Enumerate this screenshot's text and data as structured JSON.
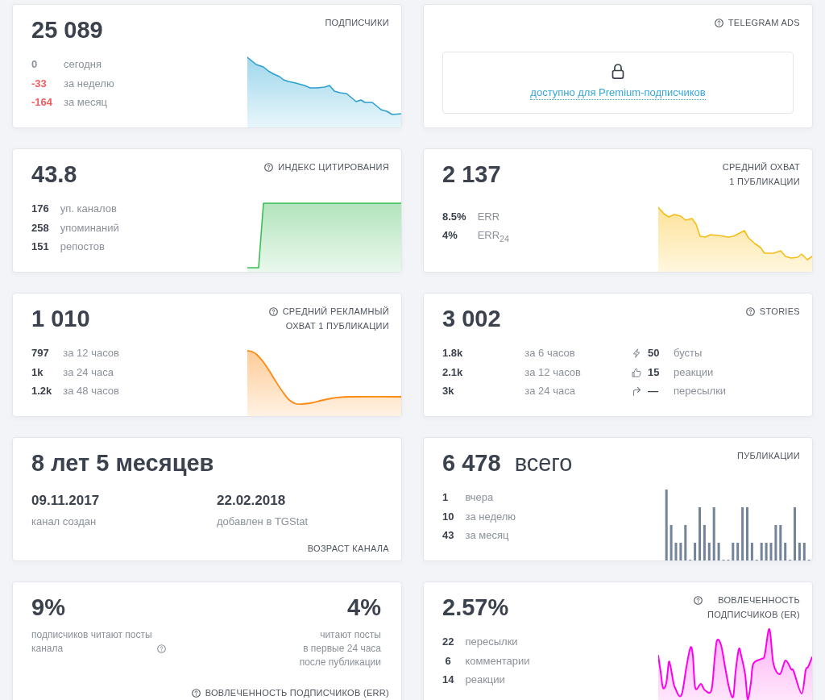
{
  "cards": [
    {
      "kind": "metric",
      "title": "ПОДПИСЧИКИ",
      "help_icon": false,
      "value": "25 089",
      "stats": [
        {
          "value": "0",
          "label": "сегодня",
          "color": "#8b919b"
        },
        {
          "value": "-33",
          "label": "за неделю",
          "color": "#f25c5e"
        },
        {
          "value": "-164",
          "label": "за месяц",
          "color": "#f25c5e"
        }
      ]
    },
    {
      "kind": "locked",
      "title": "TELEGRAM ADS",
      "help_icon": true,
      "link": "доступно для Premium-подписчиков"
    },
    {
      "kind": "metric",
      "title": "ИНДЕКС ЦИТИРОВАНИЯ",
      "help_icon": true,
      "value": "43.8",
      "stats": [
        {
          "value": "176",
          "label": "уп. каналов"
        },
        {
          "value": "258",
          "label": "упоминаний"
        },
        {
          "value": "151",
          "label": "репостов"
        }
      ]
    },
    {
      "kind": "metric",
      "title": "СРЕДНИЙ ОХВАТ\n1 ПУБЛИКАЦИИ",
      "help_icon": false,
      "value": "2 137",
      "stats": [
        {
          "value": "8.5%",
          "label": "ERR"
        },
        {
          "value": "4%",
          "label": "ERR$_{24}$"
        }
      ]
    },
    {
      "kind": "metric",
      "title": "СРЕДНИЙ РЕКЛАМНЫЙ\nОХВАТ 1 ПУБЛИКАЦИИ",
      "help_icon": true,
      "value": "1 010",
      "stats": [
        {
          "value": "797",
          "label": "за 12 часов"
        },
        {
          "value": "1k",
          "label": "за 24 часа"
        },
        {
          "value": "1.2k",
          "label": "за 48 часов"
        }
      ]
    },
    {
      "kind": "stories",
      "title": "STORIES",
      "help_icon": true,
      "value": "3 002",
      "stats": [
        {
          "value": "1.8k",
          "label": "за 6 часов"
        },
        {
          "value": "2.1k",
          "label": "за 12 часов"
        },
        {
          "value": "3k",
          "label": "за 24 часа"
        }
      ],
      "extras": [
        {
          "kind": "boost",
          "value": "50",
          "label": "бусты"
        },
        {
          "kind": "like",
          "value": "15",
          "label": "реакции"
        },
        {
          "kind": "forward",
          "value": "—",
          "label": "пересылки"
        }
      ]
    },
    {
      "kind": "age",
      "title": "ВОЗРАСТ КАНАЛА",
      "help_icon": false,
      "value": "8 лет 5 месяцев",
      "dates": [
        {
          "date": "09.11.2017",
          "caption": "канал создан"
        },
        {
          "date": "22.02.2018",
          "caption": "добавлен в TGStat"
        }
      ]
    },
    {
      "kind": "metric",
      "title": "ПУБЛИКАЦИИ",
      "help_icon": false,
      "value": "6 478",
      "unit": "всего",
      "stats": [
        {
          "value": "1",
          "label": "вчера"
        },
        {
          "value": "10",
          "label": "за неделю"
        },
        {
          "value": "43",
          "label": "за месяц"
        }
      ]
    },
    {
      "kind": "ratio",
      "title": "ВОВЛЕЧЕННОСТЬ ПОДПИСЧИКОВ (ERR)",
      "help_icon": true,
      "columns": [
        {
          "value": "9%",
          "caption": "подписчиков читают посты\nканала",
          "help_icon": true
        },
        {
          "value": "4%",
          "caption": "читают посты\nв первые 24 часа\nпосле публикации",
          "help_icon": false
        }
      ]
    },
    {
      "kind": "metric",
      "title": "ВОВЛЕЧЕННОСТЬ\nПОДПИСЧИКОВ (ER)",
      "help_icon": true,
      "value": "2.57%",
      "stats": [
        {
          "value": "22",
          "label": "пересылки"
        },
        {
          "value": "6",
          "label": "комментарии"
        },
        {
          "value": "14",
          "label": "реакции"
        }
      ]
    }
  ]
}
